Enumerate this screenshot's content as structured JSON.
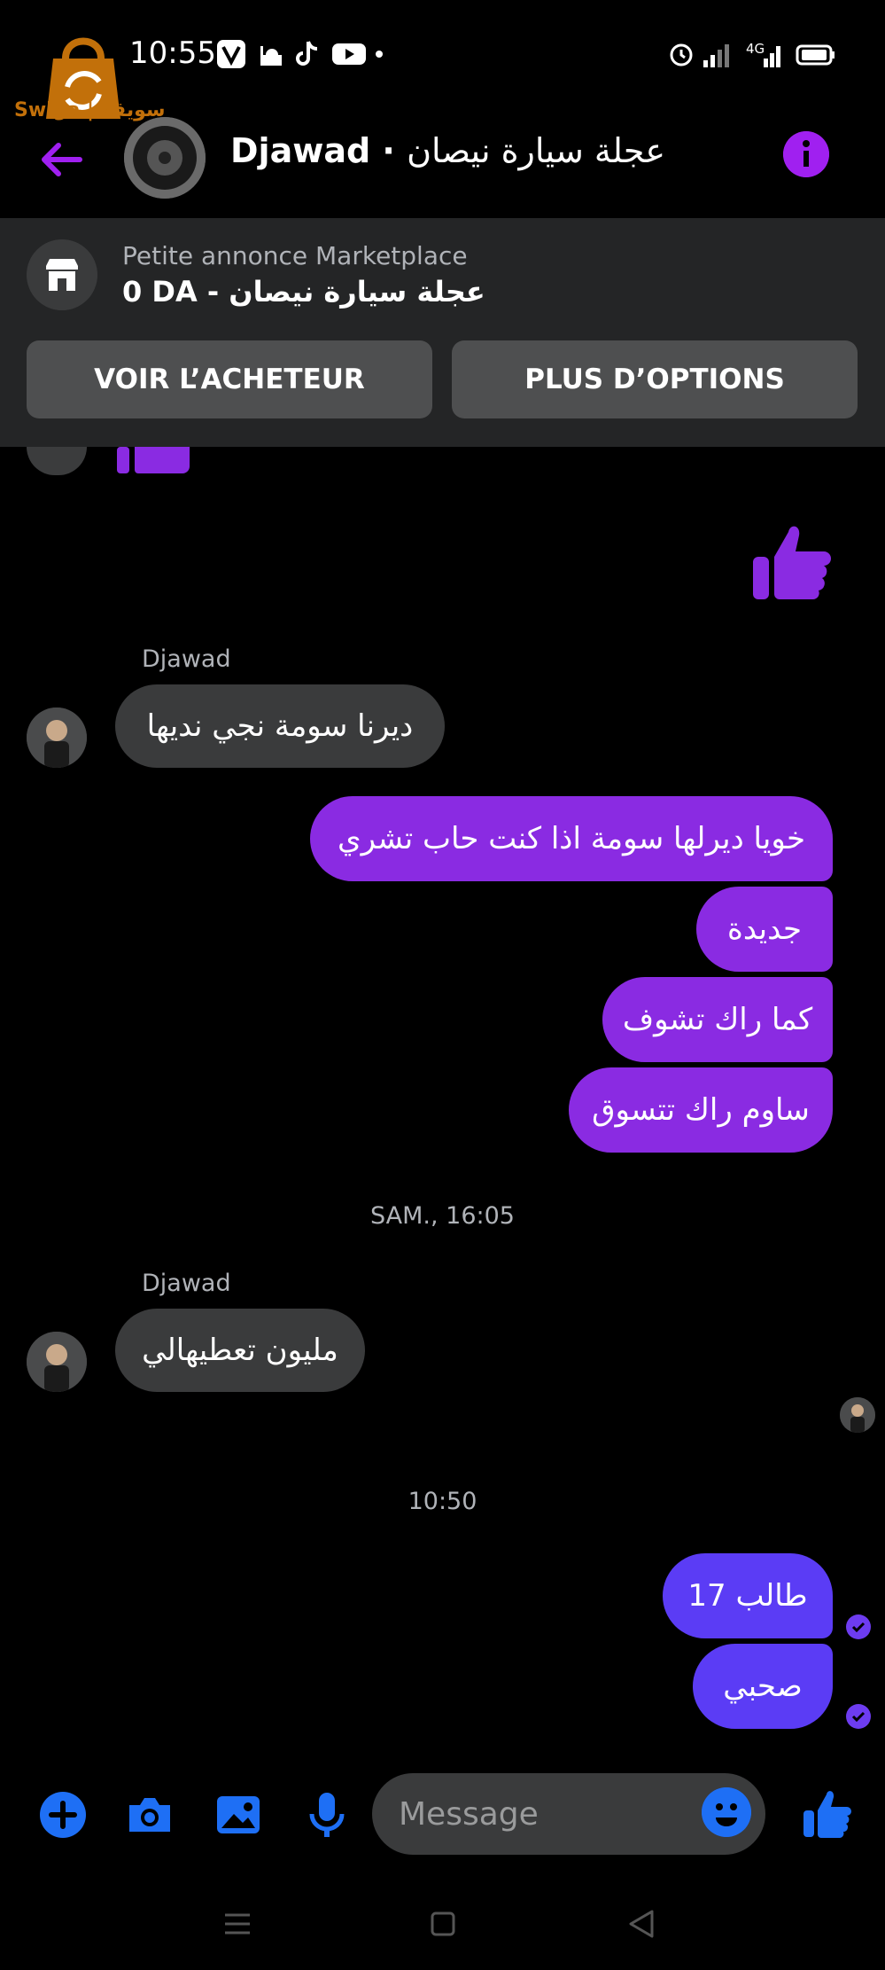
{
  "status_bar": {
    "time": "10:55",
    "network": "4G",
    "watermark_text": "Swiga | سويقة"
  },
  "header": {
    "contact_name": "Djawad",
    "listing_title": "عجلة سيارة نيصان"
  },
  "marketplace": {
    "label": "Petite annonce Marketplace",
    "listing": "0 DA - عجلة سيارة نيصان",
    "buttons": {
      "view_buyer": "VOIR L’ACHETEUR",
      "more_options": "PLUS D’OPTIONS"
    }
  },
  "conversation": {
    "sender_1": "Djawad",
    "msg_in_1": "ديرنا سومة نجي نديها",
    "msg_out_1": "خويا ديرلها سومة اذا كنت حاب تشري",
    "msg_out_2": "جديدة",
    "msg_out_3": "كما راك تشوف",
    "msg_out_4": "ساوم راك تتسوق",
    "timestamp_1": "SAM., 16:05",
    "sender_2": "Djawad",
    "msg_in_2": "مليون تعطيهالي",
    "timestamp_2": "10:50",
    "msg_out_5": "طالب 17",
    "msg_out_6": "صحبي"
  },
  "composer": {
    "placeholder": "Message"
  },
  "colors": {
    "accent_purple": "#a020f0",
    "bubble_purple": "#8a2be2",
    "bubble_blue": "#5b3cf5",
    "incoming_bubble": "#3a3b3c",
    "composer_blue": "#1e6ff5"
  }
}
